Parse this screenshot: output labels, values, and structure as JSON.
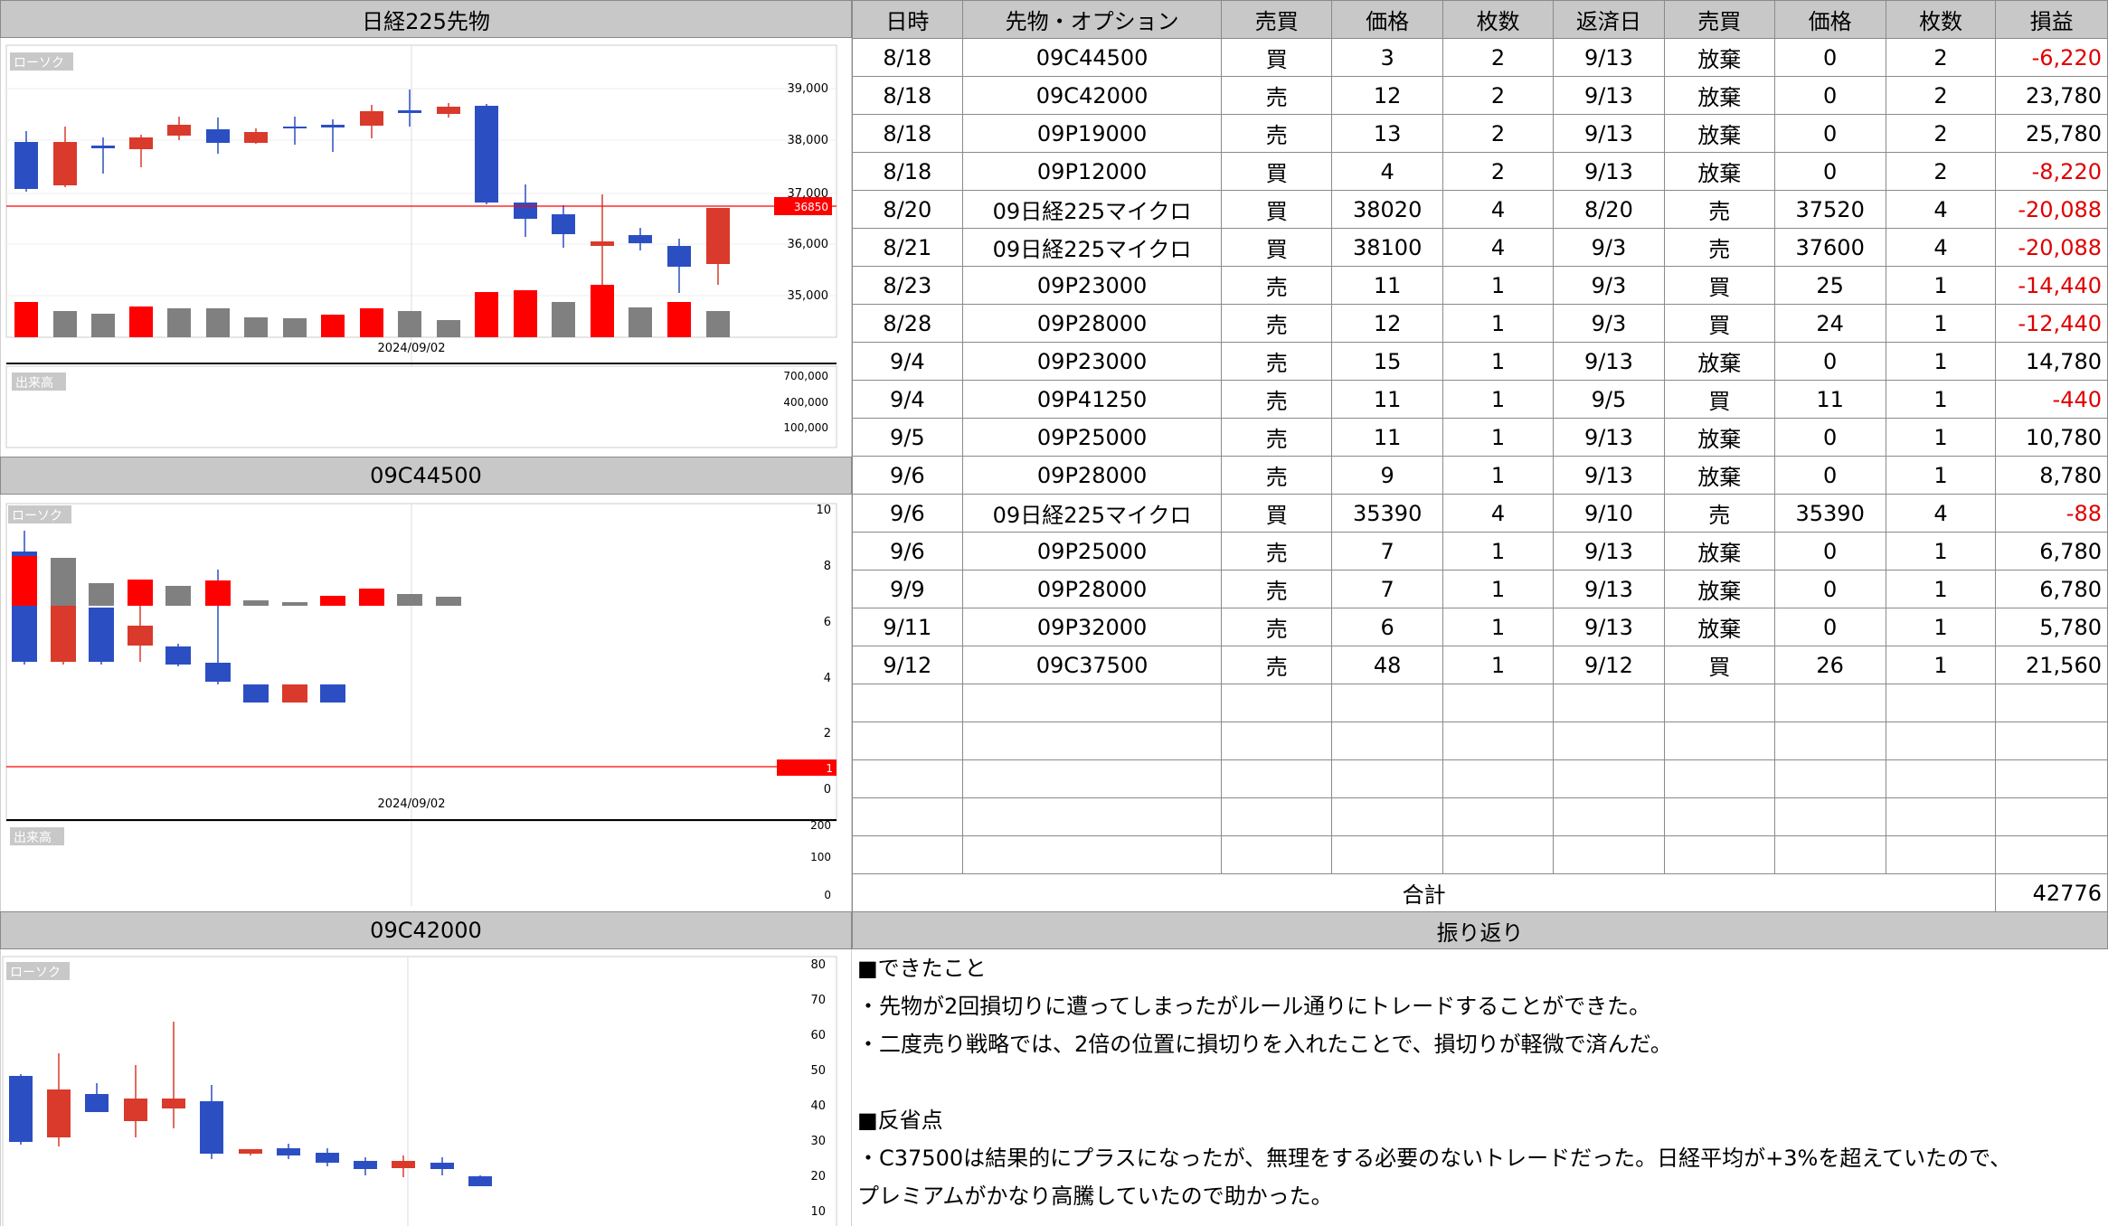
{
  "panels": {
    "nikkei": {
      "title": "日経225先物",
      "candle_label": "ローソク",
      "volume_label": "出来高",
      "date_label": "2024/09/02",
      "price_ticks": [
        "39,000",
        "38,000",
        "37,000",
        "36,000",
        "35,000"
      ],
      "current_price": "36850",
      "volume_ticks": [
        "700,000",
        "400,000",
        "100,000"
      ]
    },
    "c44500": {
      "title": "09C44500",
      "candle_label": "ローソク",
      "volume_label": "出来高",
      "date_label": "2024/09/02",
      "price_ticks": [
        "10",
        "8",
        "6",
        "4",
        "2",
        "0"
      ],
      "current_price": "1",
      "volume_ticks": [
        "200",
        "100",
        "0"
      ]
    },
    "c42000": {
      "title": "09C42000",
      "candle_label": "ローソク",
      "price_ticks": [
        "80",
        "70",
        "60",
        "50",
        "40",
        "30",
        "20",
        "10"
      ]
    }
  },
  "table": {
    "headers": [
      "日時",
      "先物・オプション",
      "売買",
      "価格",
      "枚数",
      "返済日",
      "売買",
      "価格",
      "枚数",
      "損益"
    ],
    "rows": [
      [
        "8/18",
        "09C44500",
        "買",
        "3",
        "2",
        "9/13",
        "放棄",
        "0",
        "2",
        "-6,220"
      ],
      [
        "8/18",
        "09C42000",
        "売",
        "12",
        "2",
        "9/13",
        "放棄",
        "0",
        "2",
        "23,780"
      ],
      [
        "8/18",
        "09P19000",
        "売",
        "13",
        "2",
        "9/13",
        "放棄",
        "0",
        "2",
        "25,780"
      ],
      [
        "8/18",
        "09P12000",
        "買",
        "4",
        "2",
        "9/13",
        "放棄",
        "0",
        "2",
        "-8,220"
      ],
      [
        "8/20",
        "09日経225マイクロ",
        "買",
        "38020",
        "4",
        "8/20",
        "売",
        "37520",
        "4",
        "-20,088"
      ],
      [
        "8/21",
        "09日経225マイクロ",
        "買",
        "38100",
        "4",
        "9/3",
        "売",
        "37600",
        "4",
        "-20,088"
      ],
      [
        "8/23",
        "09P23000",
        "売",
        "11",
        "1",
        "9/3",
        "買",
        "25",
        "1",
        "-14,440"
      ],
      [
        "8/28",
        "09P28000",
        "売",
        "12",
        "1",
        "9/3",
        "買",
        "24",
        "1",
        "-12,440"
      ],
      [
        "9/4",
        "09P23000",
        "売",
        "15",
        "1",
        "9/13",
        "放棄",
        "0",
        "1",
        "14,780"
      ],
      [
        "9/4",
        "09P41250",
        "売",
        "11",
        "1",
        "9/5",
        "買",
        "11",
        "1",
        "-440"
      ],
      [
        "9/5",
        "09P25000",
        "売",
        "11",
        "1",
        "9/13",
        "放棄",
        "0",
        "1",
        "10,780"
      ],
      [
        "9/6",
        "09P28000",
        "売",
        "9",
        "1",
        "9/13",
        "放棄",
        "0",
        "1",
        "8,780"
      ],
      [
        "9/6",
        "09日経225マイクロ",
        "買",
        "35390",
        "4",
        "9/10",
        "売",
        "35390",
        "4",
        "-88"
      ],
      [
        "9/6",
        "09P25000",
        "売",
        "7",
        "1",
        "9/13",
        "放棄",
        "0",
        "1",
        "6,780"
      ],
      [
        "9/9",
        "09P28000",
        "売",
        "7",
        "1",
        "9/13",
        "放棄",
        "0",
        "1",
        "6,780"
      ],
      [
        "9/11",
        "09P32000",
        "売",
        "6",
        "1",
        "9/13",
        "放棄",
        "0",
        "1",
        "5,780"
      ],
      [
        "9/12",
        "09C37500",
        "売",
        "48",
        "1",
        "9/12",
        "買",
        "26",
        "1",
        "21,560"
      ]
    ],
    "empty_rows": 5,
    "total_label": "合計",
    "total_value": "42776"
  },
  "review": {
    "title": "振り返り",
    "lines": [
      "■できたこと",
      "・先物が2回損切りに遭ってしまったがルール通りにトレードすることができた。",
      "・二度売り戦略では、2倍の位置に損切りを入れたことで、損切りが軽微で済んだ。",
      "",
      "■反省点",
      "・C37500は結果的にプラスになったが、無理をする必要のないトレードだった。日経平均が+3%を超えていたので、",
      "プレミアムがかなり高騰していたので助かった。"
    ]
  },
  "colors": {
    "up": "#d93a2b",
    "down": "#2b4fc3",
    "vol_up": "#ff0000",
    "vol_neutral": "#808080",
    "header": "#c8c8c8",
    "loss": "#e00000"
  }
}
